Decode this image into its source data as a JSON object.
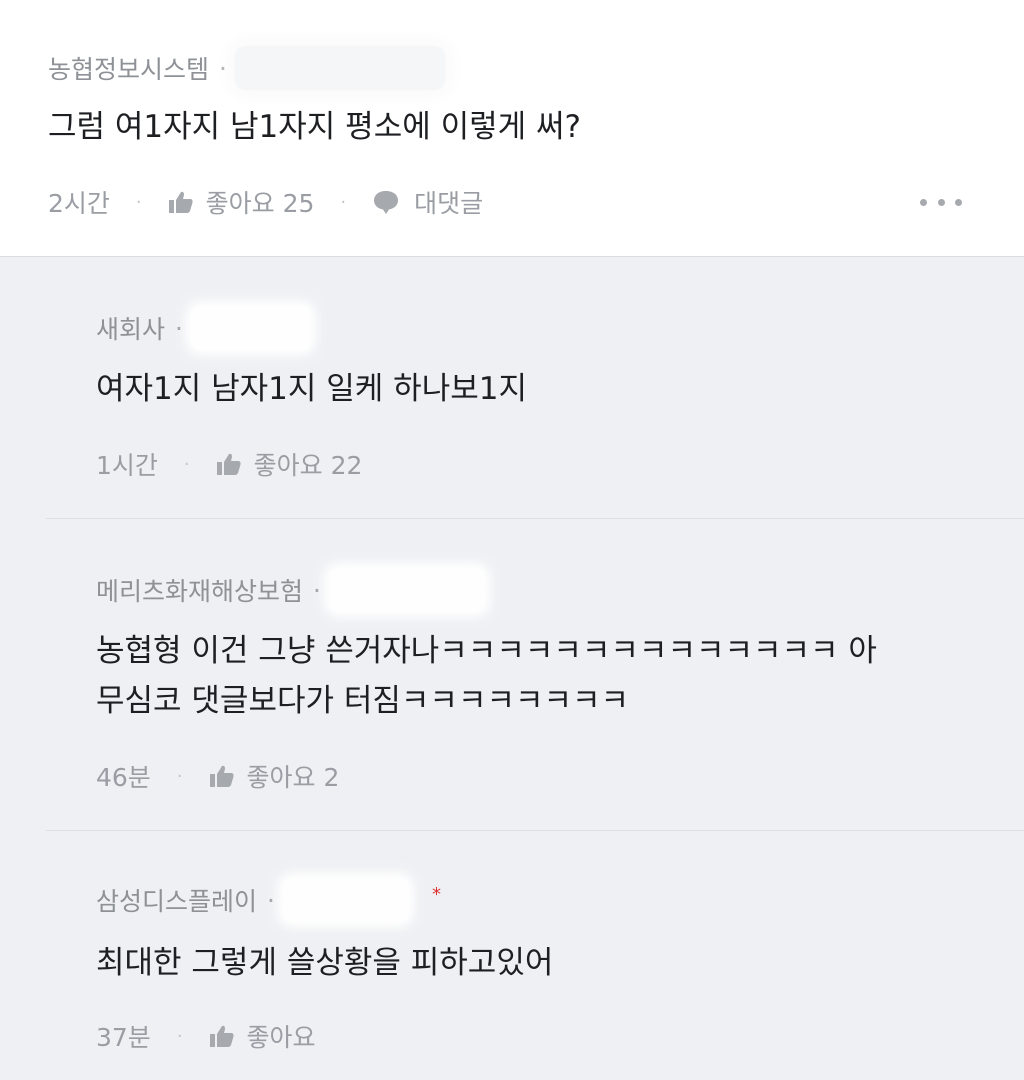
{
  "main_comment": {
    "author": "농협정보시스템",
    "dot": "·",
    "text": "그럼 여1자지 남1자지 평소에 이렇게 써?",
    "time": "2시간",
    "sep": "·",
    "like_label": "좋아요 25",
    "reply_label": "대댓글"
  },
  "replies": [
    {
      "author": "새회사",
      "dot": "·",
      "text_lines": [
        "여자1지 남자1지 일케 하나보1지"
      ],
      "time": "1시간",
      "sep": "·",
      "like_label": "좋아요 22"
    },
    {
      "author": "메리츠화재해상보험",
      "dot": "·",
      "text_lines": [
        "농협형 이건 그냥 쓴거자나ㅋㅋㅋㅋㅋㅋㅋㅋㅋㅋㅋㅋㅋㅋ 아",
        "무심코 댓글보다가 터짐ㅋㅋㅋㅋㅋㅋㅋㅋ"
      ],
      "time": "46분",
      "sep": "·",
      "like_label": "좋아요 2"
    },
    {
      "author": "삼성디스플레이",
      "dot": "·",
      "text_lines": [
        "최대한 그렇게 쓸상황을 피하고있어"
      ],
      "time": "37분",
      "sep": "·",
      "like_label": "좋아요"
    }
  ],
  "colors": {
    "background": "#eef0f3",
    "main_card": "#ffffff",
    "muted_text": "#9a9da3",
    "red_mark": "#e03131"
  },
  "icons": {
    "like": "thumbs-up-icon",
    "reply": "speech-bubble-icon",
    "more": "more-dots-icon"
  }
}
